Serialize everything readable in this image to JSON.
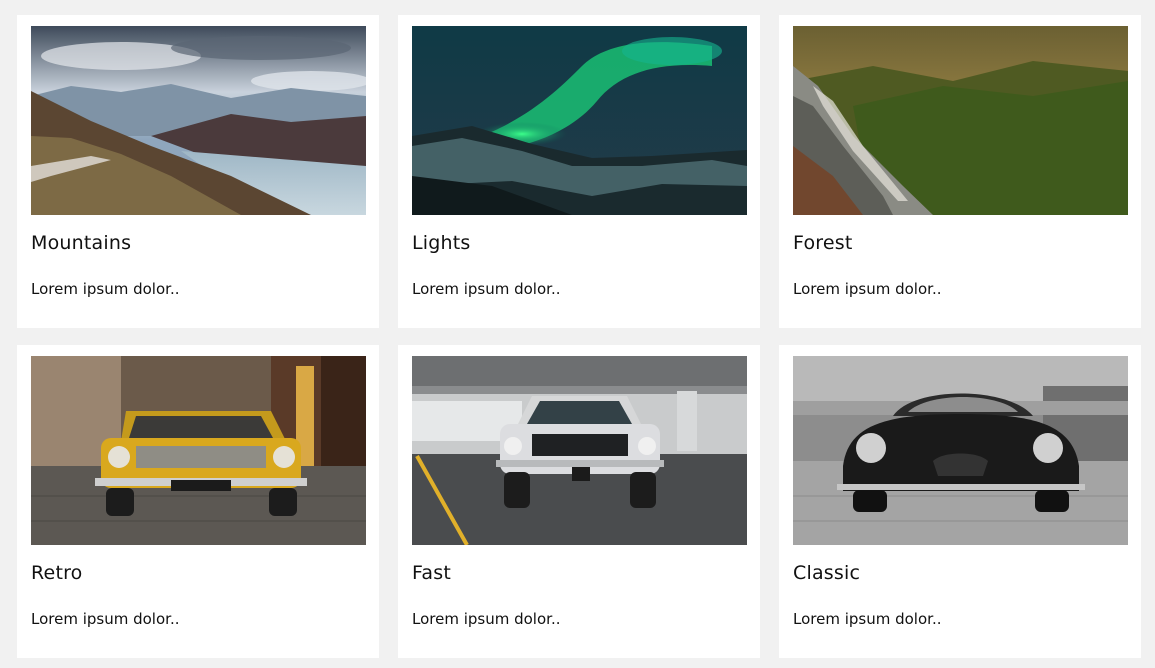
{
  "cards": [
    {
      "title": "Mountains",
      "description": "Lorem ipsum dolor..",
      "image": "mountains-lake-photo"
    },
    {
      "title": "Lights",
      "description": "Lorem ipsum dolor..",
      "image": "aurora-lights-photo"
    },
    {
      "title": "Forest",
      "description": "Lorem ipsum dolor..",
      "image": "forest-valley-photo"
    },
    {
      "title": "Retro",
      "description": "Lorem ipsum dolor..",
      "image": "yellow-retro-car-photo"
    },
    {
      "title": "Fast",
      "description": "Lorem ipsum dolor..",
      "image": "white-muscle-car-photo"
    },
    {
      "title": "Classic",
      "description": "Lorem ipsum dolor..",
      "image": "black-classic-car-photo"
    }
  ],
  "colors": {
    "page_background": "#f1f1f1",
    "card_background": "#ffffff",
    "text": "#111111"
  }
}
